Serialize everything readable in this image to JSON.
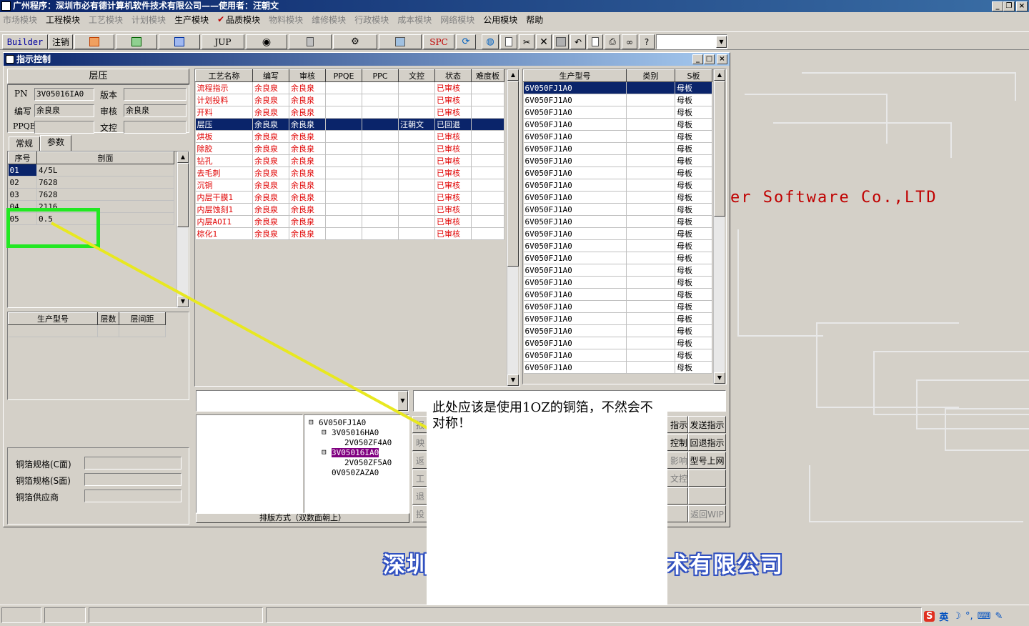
{
  "window": {
    "title": "广州程序：深圳市必有德计算机软件技术有限公司——使用者：汪朝文"
  },
  "menu": [
    {
      "label": "市场模块",
      "enabled": false
    },
    {
      "label": "工程模块",
      "enabled": true
    },
    {
      "label": "工艺模块",
      "enabled": false
    },
    {
      "label": "计划模块",
      "enabled": false
    },
    {
      "label": "生产模块",
      "enabled": true
    },
    {
      "label": "品质模块",
      "enabled": true
    },
    {
      "label": "物料模块",
      "enabled": false
    },
    {
      "label": "维修模块",
      "enabled": false
    },
    {
      "label": "行政模块",
      "enabled": false
    },
    {
      "label": "成本模块",
      "enabled": false
    },
    {
      "label": "网络模块",
      "enabled": false
    },
    {
      "label": "公用模块",
      "enabled": true
    },
    {
      "label": "帮助",
      "enabled": true
    }
  ],
  "toolbar": {
    "builder": "Builder",
    "logout": "注销",
    "jup": "JUP",
    "spc": "SPC"
  },
  "child": {
    "title": "指示控制"
  },
  "left": {
    "section_title": "层压",
    "pn_label": "PN",
    "pn_value": "3V05016IA0",
    "version_label": "版本",
    "version_value": "",
    "editor_label": "编写",
    "editor_value": "余良泉",
    "reviewer_label": "审核",
    "reviewer_value": "余良泉",
    "ppqe_label": "PPQE",
    "ppqe_value": "",
    "doc_label": "文控",
    "doc_value": "",
    "tabs": [
      "常规",
      "参数"
    ],
    "grid_headers": [
      "序号",
      "剖面"
    ],
    "grid_rows": [
      [
        "01",
        "4/5L"
      ],
      [
        "02",
        "7628"
      ],
      [
        "03",
        "7628"
      ],
      [
        "04",
        "2116"
      ],
      [
        "05",
        "0.5"
      ]
    ],
    "lower_headers": [
      "生产型号",
      "层数",
      "层间距"
    ],
    "foil_c_label": "铜箔规格(C面)",
    "foil_s_label": "铜箔规格(S面)",
    "foil_vendor_label": "铜箔供应商"
  },
  "process": {
    "headers": [
      "工艺名称",
      "编写",
      "审核",
      "PPQE",
      "PPC",
      "文控",
      "状态",
      "难度板"
    ],
    "rows": [
      [
        "流程指示",
        "余良泉",
        "余良泉",
        "",
        "",
        "",
        "已审核",
        ""
      ],
      [
        "计划投料",
        "余良泉",
        "余良泉",
        "",
        "",
        "",
        "已审核",
        ""
      ],
      [
        "开料",
        "余良泉",
        "余良泉",
        "",
        "",
        "",
        "已审核",
        ""
      ],
      [
        "层压",
        "余良泉",
        "余良泉",
        "",
        "",
        "汪朝文",
        "已回退",
        ""
      ],
      [
        "烘板",
        "余良泉",
        "余良泉",
        "",
        "",
        "",
        "已审核",
        ""
      ],
      [
        "除胶",
        "余良泉",
        "余良泉",
        "",
        "",
        "",
        "已审核",
        ""
      ],
      [
        "钻孔",
        "余良泉",
        "余良泉",
        "",
        "",
        "",
        "已审核",
        ""
      ],
      [
        "去毛刺",
        "余良泉",
        "余良泉",
        "",
        "",
        "",
        "已审核",
        ""
      ],
      [
        "沉铜",
        "余良泉",
        "余良泉",
        "",
        "",
        "",
        "已审核",
        ""
      ],
      [
        "内层干膜1",
        "余良泉",
        "余良泉",
        "",
        "",
        "",
        "已审核",
        ""
      ],
      [
        "内层蚀刻1",
        "余良泉",
        "余良泉",
        "",
        "",
        "",
        "已审核",
        ""
      ],
      [
        "内层AOI1",
        "余良泉",
        "余良泉",
        "",
        "",
        "",
        "已审核",
        ""
      ],
      [
        "棕化1",
        "余良泉",
        "余良泉",
        "",
        "",
        "",
        "已审核",
        ""
      ]
    ]
  },
  "models": {
    "headers": [
      "生产型号",
      "类别",
      "S板"
    ],
    "rows": [
      [
        "6V050FJ1A0",
        "",
        "母板"
      ],
      [
        "6V050FJ1A0",
        "",
        "母板"
      ],
      [
        "6V050FJ1A0",
        "",
        "母板"
      ],
      [
        "6V050FJ1A0",
        "",
        "母板"
      ],
      [
        "6V050FJ1A0",
        "",
        "母板"
      ],
      [
        "6V050FJ1A0",
        "",
        "母板"
      ],
      [
        "6V050FJ1A0",
        "",
        "母板"
      ],
      [
        "6V050FJ1A0",
        "",
        "母板"
      ],
      [
        "6V050FJ1A0",
        "",
        "母板"
      ],
      [
        "6V050FJ1A0",
        "",
        "母板"
      ],
      [
        "6V050FJ1A0",
        "",
        "母板"
      ],
      [
        "6V050FJ1A0",
        "",
        "母板"
      ],
      [
        "6V050FJ1A0",
        "",
        "母板"
      ],
      [
        "6V050FJ1A0",
        "",
        "母板"
      ],
      [
        "6V050FJ1A0",
        "",
        "母板"
      ],
      [
        "6V050FJ1A0",
        "",
        "母板"
      ],
      [
        "6V050FJ1A0",
        "",
        "母板"
      ],
      [
        "6V050FJ1A0",
        "",
        "母板"
      ],
      [
        "6V050FJ1A0",
        "",
        "母板"
      ],
      [
        "6V050FJ1A0",
        "",
        "母板"
      ],
      [
        "6V050FJ1A0",
        "",
        "母板"
      ],
      [
        "6V050FJ1A0",
        "",
        "母板"
      ],
      [
        "6V050FJ1A0",
        "",
        "母板"
      ],
      [
        "6V050FJ1A0",
        "",
        "母板"
      ]
    ]
  },
  "tree": {
    "nodes": [
      {
        "label": "6V050FJ1A0",
        "level": 0,
        "expanded": true
      },
      {
        "label": "3V05016HA0",
        "level": 1,
        "expanded": true
      },
      {
        "label": "2V050ZF4A0",
        "level": 2
      },
      {
        "label": "3V05016IA0",
        "level": 1,
        "expanded": true,
        "selected": true
      },
      {
        "label": "2V050ZF5A0",
        "level": 2
      },
      {
        "label": "0V050ZAZA0",
        "level": 1
      }
    ]
  },
  "layout_label": "排版方式（双数面朝上）",
  "buttons_left": [
    "报",
    "映",
    "返",
    "工",
    "退",
    "投"
  ],
  "buttons_right": [
    [
      "指示",
      "发送指示"
    ],
    [
      "控制",
      "回退指示"
    ],
    [
      "影响",
      "型号上网"
    ],
    [
      "文控",
      ""
    ],
    [
      "",
      ""
    ],
    [
      "",
      "返回WIP"
    ]
  ],
  "background": {
    "english": "er Software Co.,LTD",
    "company": "深圳市必有德计算机软件技术有限公司"
  },
  "annotation": {
    "text": "此处应该是使用1OZ的铜箔，不然会不对称！"
  },
  "tray": {
    "ime": "英"
  }
}
